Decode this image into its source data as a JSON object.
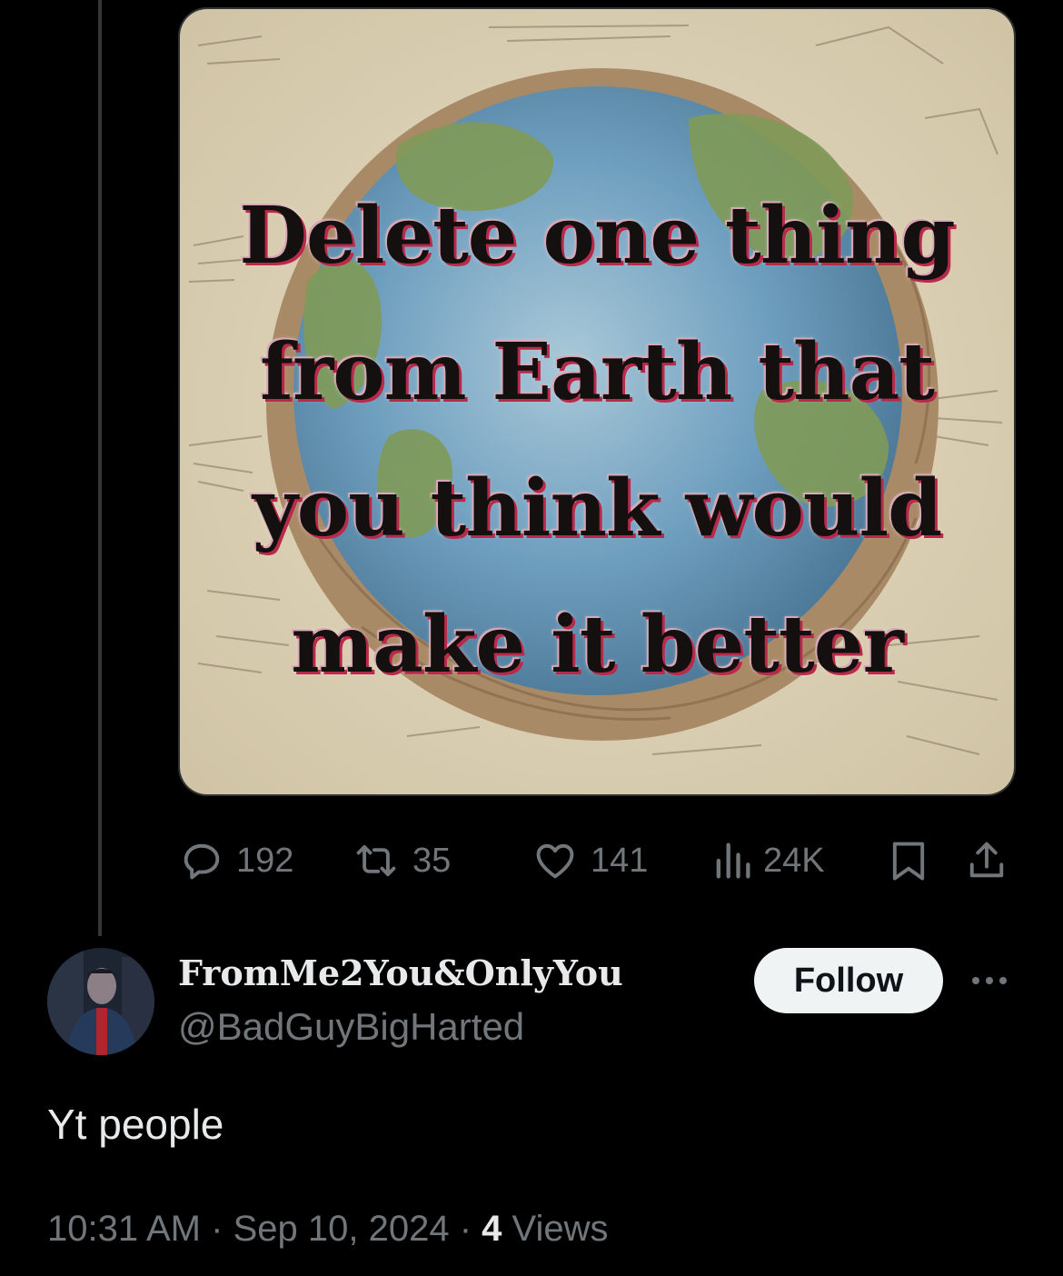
{
  "tweet": {
    "image_caption_lines": [
      "Delete one thing",
      "from Earth that",
      "you think would",
      "make it better"
    ],
    "actions": {
      "replies": "192",
      "reposts": "35",
      "likes": "141",
      "views": "24K"
    }
  },
  "reply": {
    "display_name": "FromMe2You&OnlyYou",
    "handle": "@BadGuyBigHarted",
    "follow_label": "Follow",
    "text": "Yt people",
    "time": "10:31 AM",
    "separator": "·",
    "date": "Sep 10, 2024",
    "views_count": "4",
    "views_label": "Views"
  },
  "colors": {
    "background": "#000000",
    "text_primary": "#e7e9ea",
    "text_secondary": "#71767b",
    "follow_button_bg": "#eff3f4"
  },
  "icons": [
    "reply-icon",
    "repost-icon",
    "like-icon",
    "views-icon",
    "bookmark-icon",
    "share-icon",
    "more-icon"
  ]
}
